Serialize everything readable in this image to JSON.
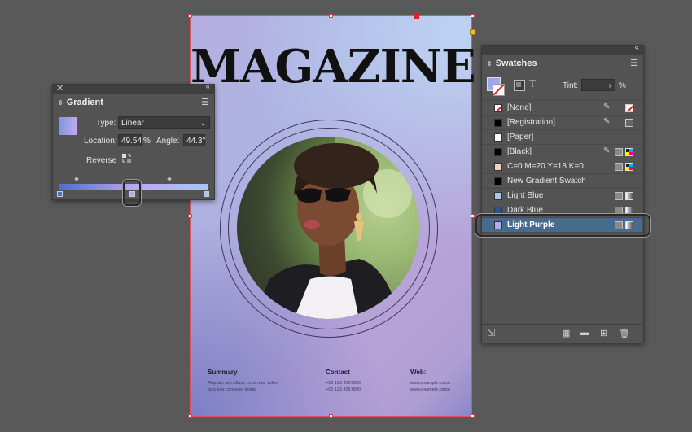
{
  "document": {
    "title": "MAGAZINE",
    "footer": {
      "summary": {
        "heading": "Summary",
        "lines": [
          "Aliquam se nollam, cons nus, volen",
          "quis eos consequi dolup"
        ]
      },
      "contact": {
        "heading": "Contact",
        "lines": [
          "+00 123 4567890",
          "+00 123 4567890"
        ]
      },
      "web": {
        "heading": "Web:",
        "lines": [
          "www.example.come",
          "www.example.come"
        ]
      }
    }
  },
  "gradient_panel": {
    "title": "Gradient",
    "type_label": "Type:",
    "type_value": "Linear",
    "location_label": "Location:",
    "location_value": "49.54",
    "location_unit": "%",
    "angle_label": "Angle:",
    "angle_value": "44.3°",
    "reverse_label": "Reverse",
    "colors": {
      "start": "#4e6fcf",
      "mid": "#b8a8ee",
      "end": "#aac5f3"
    }
  },
  "swatches_panel": {
    "title": "Swatches",
    "tint_label": "Tint:",
    "tint_unit": "%",
    "items": [
      {
        "name": "[None]",
        "color": "#ffffff"
      },
      {
        "name": "[Registration]",
        "color": "#000000"
      },
      {
        "name": "[Paper]",
        "color": "#ffffff"
      },
      {
        "name": "[Black]",
        "color": "#000000"
      },
      {
        "name": "C=0 M=20 Y=18 K=0",
        "color": "#f7cfc6"
      },
      {
        "name": "New Gradient Swatch",
        "color": "#000000"
      },
      {
        "name": "Light Blue",
        "color": "#a6c8f0"
      },
      {
        "name": "Dark Blue",
        "color": "#2b5590"
      },
      {
        "name": "Light Purple",
        "color": "#b4a8ee",
        "selected": true
      }
    ],
    "accent_selected": "#476a8f"
  }
}
